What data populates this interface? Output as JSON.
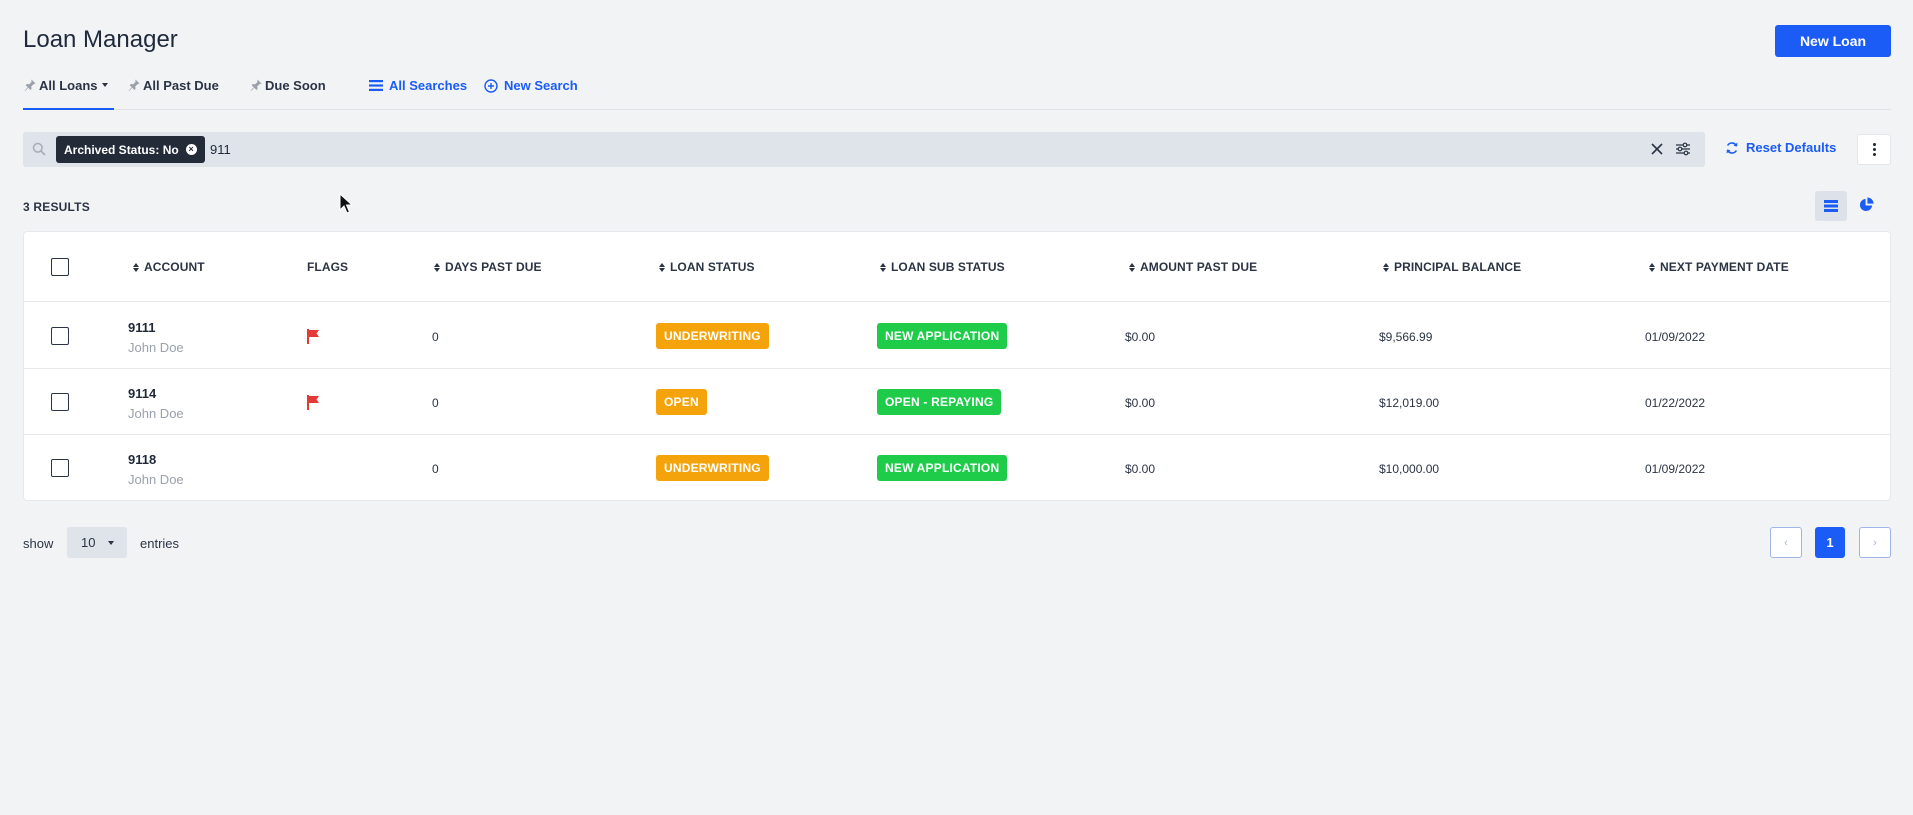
{
  "header": {
    "title": "Loan Manager",
    "new_loan_label": "New Loan"
  },
  "tabs": [
    {
      "label": "All Loans",
      "active": true,
      "dropdown": true
    },
    {
      "label": "All Past Due"
    },
    {
      "label": "Due Soon"
    }
  ],
  "links": {
    "all_searches": "All Searches",
    "new_search": "New Search"
  },
  "search": {
    "chip_label": "Archived Status: No",
    "query": "911",
    "reset_label": "Reset Defaults"
  },
  "results": {
    "count_label": "3 RESULTS"
  },
  "table": {
    "columns": [
      "ACCOUNT",
      "FLAGS",
      "DAYS PAST DUE",
      "LOAN STATUS",
      "LOAN SUB STATUS",
      "AMOUNT PAST DUE",
      "PRINCIPAL BALANCE",
      "NEXT PAYMENT DATE"
    ],
    "rows": [
      {
        "account": "9111",
        "name": "John Doe",
        "flag": true,
        "days_past_due": "0",
        "loan_status": "UNDERWRITING",
        "loan_status_color": "#f5a30a",
        "sub_status": "NEW APPLICATION",
        "sub_status_color": "#1ecc4a",
        "amount_past_due": "$0.00",
        "principal_balance": "$9,566.99",
        "next_payment_date": "01/09/2022"
      },
      {
        "account": "9114",
        "name": "John Doe",
        "flag": true,
        "days_past_due": "0",
        "loan_status": "OPEN",
        "loan_status_color": "#f5a30a",
        "sub_status": "OPEN - REPAYING",
        "sub_status_color": "#1ecc4a",
        "amount_past_due": "$0.00",
        "principal_balance": "$12,019.00",
        "next_payment_date": "01/22/2022"
      },
      {
        "account": "9118",
        "name": "John Doe",
        "flag": false,
        "days_past_due": "0",
        "loan_status": "UNDERWRITING",
        "loan_status_color": "#f5a30a",
        "sub_status": "NEW APPLICATION",
        "sub_status_color": "#1ecc4a",
        "amount_past_due": "$0.00",
        "principal_balance": "$10,000.00",
        "next_payment_date": "01/09/2022"
      }
    ]
  },
  "pagination": {
    "show_label": "show",
    "per_page": "10",
    "entries_label": "entries",
    "current_page": "1",
    "prev_glyph": "‹",
    "next_glyph": "›"
  },
  "colors": {
    "accent": "#1a5cf5",
    "flag": "#e53935"
  },
  "icons": [
    "search-icon",
    "pin-icon",
    "list-icon",
    "plus-circle-icon",
    "close-icon",
    "filter-icon",
    "refresh-icon",
    "kebab-icon",
    "list-view-icon",
    "pie-chart-icon",
    "flag-icon",
    "cursor-icon"
  ]
}
